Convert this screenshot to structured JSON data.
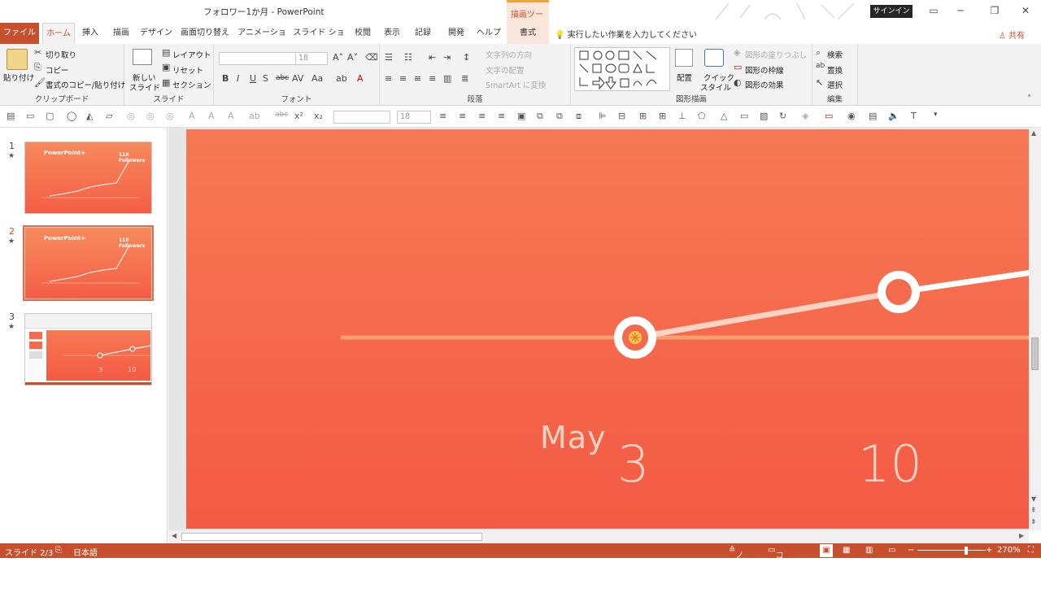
{
  "window": {
    "title": "フォロワー1か月  -  PowerPoint",
    "context_tab_header": "描画ツール",
    "signin": "サインイン"
  },
  "tabs": [
    {
      "label": "ファイル"
    },
    {
      "label": "ホーム"
    },
    {
      "label": "挿入"
    },
    {
      "label": "描画"
    },
    {
      "label": "デザイン"
    },
    {
      "label": "画面切り替え"
    },
    {
      "label": "アニメーション"
    },
    {
      "label": "スライド ショー"
    },
    {
      "label": "校閲"
    },
    {
      "label": "表示"
    },
    {
      "label": "記録"
    },
    {
      "label": "開発"
    },
    {
      "label": "ヘルプ"
    },
    {
      "label": "書式"
    }
  ],
  "tell_me": "実行したい作業を入力してください",
  "share": "共有",
  "ribbon": {
    "clipboard": {
      "label": "クリップボード",
      "paste": "貼り付け",
      "cut": "切り取り",
      "copy": "コピー",
      "format_painter": "書式のコピー/貼り付け"
    },
    "slides": {
      "label": "スライド",
      "new_slide_1": "新しい",
      "new_slide_2": "スライド",
      "layout": "レイアウト",
      "reset": "リセット",
      "section": "セクション"
    },
    "font": {
      "label": "フォント",
      "size": "18"
    },
    "paragraph": {
      "label": "段落",
      "text_direction": "文字列の方向",
      "align_text": "文字の配置",
      "smartart": "SmartArt に変換"
    },
    "drawing": {
      "label": "図形描画",
      "arrange": "配置",
      "quick_styles_1": "クイック",
      "quick_styles_2": "スタイル",
      "shape_fill": "図形の塗りつぶし",
      "shape_outline": "図形の枠線",
      "shape_effects": "図形の効果"
    },
    "editing": {
      "label": "編集",
      "find": "検索",
      "replace": "置換",
      "select": "選択"
    }
  },
  "qat": {
    "font_size": "18"
  },
  "slides": [
    {
      "number": "1",
      "title": "PowerPoint+",
      "followers": "118 Followers",
      "selected": false
    },
    {
      "number": "2",
      "title": "PowerPoint+",
      "followers": "118 Followers",
      "selected": true
    },
    {
      "number": "3",
      "day_a": "3",
      "day_b": "10",
      "selected": false
    }
  ],
  "canvas": {
    "month": "May",
    "day_a": "3",
    "day_b": "10",
    "colors": {
      "bg_top": "#f67954",
      "bg_bottom": "#f45a44",
      "baseline": "#f7a070",
      "text": "#fcd3c2",
      "line": "#ffffff"
    }
  },
  "statusbar": {
    "slide_indicator": "スライド 2/3",
    "language": "日本語",
    "notes": "ノート",
    "comments": "コメント",
    "zoom": "270%"
  }
}
